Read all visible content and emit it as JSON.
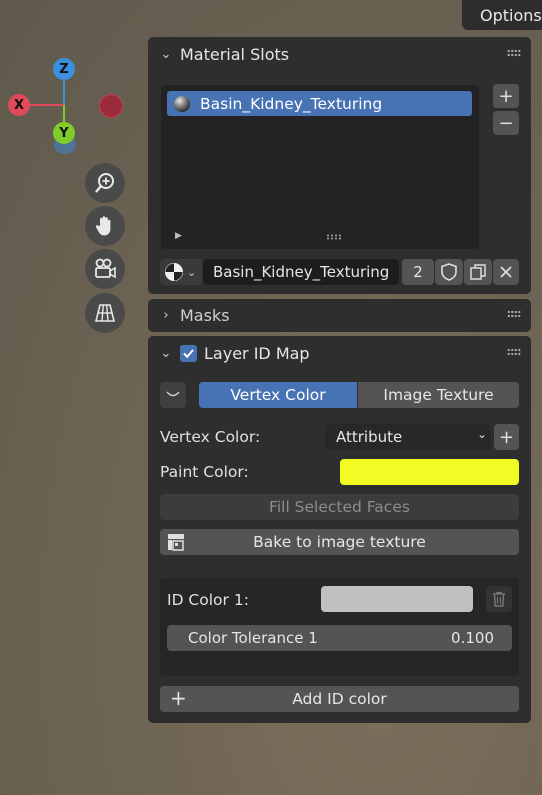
{
  "header": {
    "options_label": "Options"
  },
  "gizmo": {
    "z_label": "Z",
    "x_label": "X",
    "y_label": "Y"
  },
  "material_slots": {
    "title": "Material Slots",
    "items": [
      {
        "name": "Basin_Kidney_Texturing",
        "selected": true
      }
    ],
    "material_name": "Basin_Kidney_Texturing",
    "user_count": "2"
  },
  "masks": {
    "title": "Masks"
  },
  "layer_id_map": {
    "title": "Layer ID Map",
    "enabled": true,
    "tabs": [
      {
        "label": "Vertex Color",
        "active": true
      },
      {
        "label": "Image Texture",
        "active": false
      }
    ],
    "vertex_color_label": "Vertex Color:",
    "vertex_color_value": "Attribute",
    "paint_color_label": "Paint Color:",
    "paint_color": "#f3fb24",
    "fill_selected_label": "Fill Selected Faces",
    "bake_label": "Bake to image texture",
    "id_colors": [
      {
        "label": "ID Color 1:",
        "color": "#c0c0c0",
        "tolerance_label": "Color Tolerance 1",
        "tolerance_value": "0.100"
      }
    ],
    "add_id_label": "Add ID color"
  },
  "colors": {
    "accent": "#4772b3",
    "panel": "#2e2e2e",
    "field": "#545454"
  }
}
